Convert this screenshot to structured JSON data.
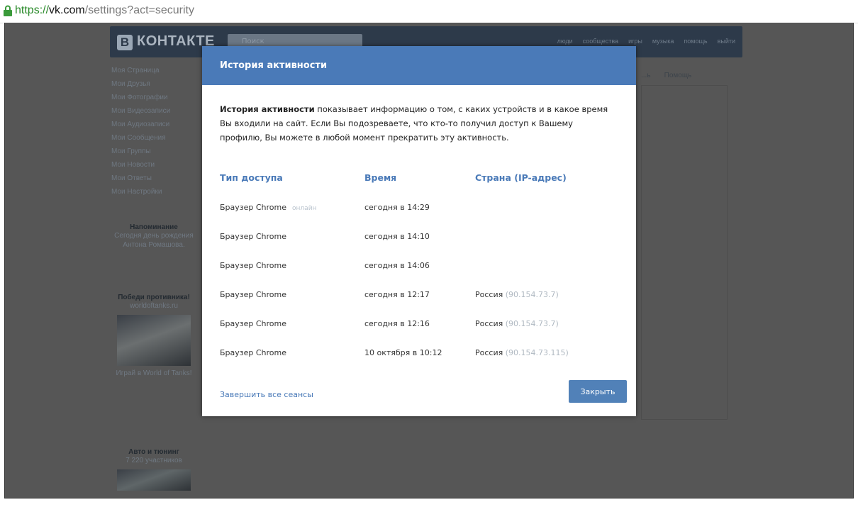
{
  "browser": {
    "url_scheme": "https://",
    "url_host": "vk.com",
    "url_path": "/settings?act=security"
  },
  "vk": {
    "logo_letter": "B",
    "logo_text": "КОНТАКТЕ",
    "search_placeholder": "Поиск",
    "nav": [
      "люди",
      "сообщества",
      "игры",
      "музыка",
      "помощь",
      "выйти"
    ]
  },
  "left_menu": [
    "Моя Страница",
    "Мои Друзья",
    "Мои Фотографии",
    "Мои Видеозаписи",
    "Мои Аудиозаписи",
    "Мои Сообщения",
    "Мои Группы",
    "Мои Новости",
    "Мои Ответы",
    "Мои Настройки"
  ],
  "side": {
    "reminder_title": "Напоминание",
    "reminder_text": "Сегодня день рождения Антона Ромашова.",
    "promo_title": "Победи противника!",
    "promo_sub": "worldoftanks.ru",
    "promo_caption": "Играй в World of Tanks!",
    "promo2_title": "Авто и тюнинг",
    "promo2_sub": "7 220 участников"
  },
  "right_tabs": [
    "...ь",
    "Помощь"
  ],
  "modal": {
    "title": "История активности",
    "desc_bold": "История активности",
    "desc_rest": " показывает информацию о том, с каких устройств и в какое время Вы входили на сайт. Если Вы подозреваете, что кто-то получил доступ к Вашему профилю, Вы можете в любой момент прекратить эту активность.",
    "columns": {
      "type": "Тип доступа",
      "time": "Время",
      "country": "Страна (IP-адрес)"
    },
    "sessions": [
      {
        "type": "Браузер Chrome",
        "status": "онлайн",
        "time": "сегодня в 14:29",
        "country": "",
        "ip": ""
      },
      {
        "type": "Браузер Chrome",
        "status": "",
        "time": "сегодня в 14:10",
        "country": "",
        "ip": ""
      },
      {
        "type": "Браузер Chrome",
        "status": "",
        "time": "сегодня в 14:06",
        "country": "",
        "ip": ""
      },
      {
        "type": "Браузер Chrome",
        "status": "",
        "time": "сегодня в 12:17",
        "country": "Россия",
        "ip": "(90.154.73.7)"
      },
      {
        "type": "Браузер Chrome",
        "status": "",
        "time": "сегодня в 12:16",
        "country": "Россия",
        "ip": "(90.154.73.7)"
      },
      {
        "type": "Браузер Chrome",
        "status": "",
        "time": "10 октября в 10:12",
        "country": "Россия",
        "ip": "(90.154.73.115)"
      }
    ],
    "terminate_label": "Завершить все сеансы",
    "close_label": "Закрыть"
  },
  "colors": {
    "modal_header": "#4a7ab8",
    "close_button": "#5181b8",
    "overlay": "#565656"
  }
}
